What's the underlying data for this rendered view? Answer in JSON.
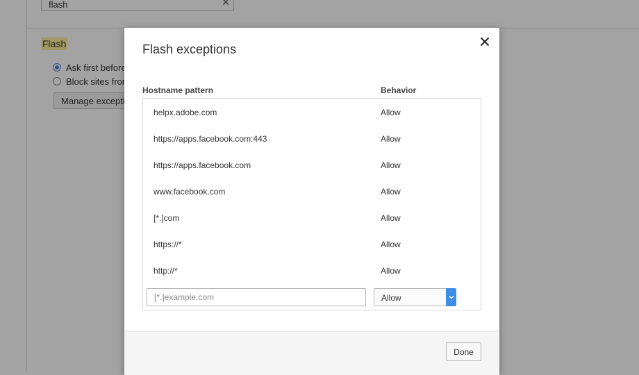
{
  "background": {
    "search": {
      "value": "flash",
      "clear_icon": "close-icon"
    },
    "section_title": "Flash",
    "radio_options": [
      {
        "label": "Ask first before",
        "checked": true
      },
      {
        "label": "Block sites from",
        "checked": false
      }
    ],
    "manage_button_label": "Manage exceptio"
  },
  "dialog": {
    "title": "Flash exceptions",
    "close_icon": "close-icon",
    "columns": {
      "host": "Hostname pattern",
      "behavior": "Behavior"
    },
    "rows": [
      {
        "host": "helpx.adobe.com",
        "behavior": "Allow"
      },
      {
        "host": "https://apps.facebook.com:443",
        "behavior": "Allow"
      },
      {
        "host": "https://apps.facebook.com",
        "behavior": "Allow"
      },
      {
        "host": "www.facebook.com",
        "behavior": "Allow"
      },
      {
        "host": "[*.]com",
        "behavior": "Allow"
      },
      {
        "host": "https://*",
        "behavior": "Allow"
      },
      {
        "host": "http://*",
        "behavior": "Allow"
      }
    ],
    "new_entry": {
      "placeholder": "[*.]example.com",
      "behavior_selected": "Allow",
      "dropdown_icon": "chevron-down-icon"
    },
    "done_label": "Done"
  },
  "colors": {
    "accent": "#3f8ee6",
    "highlight": "#fdf19a"
  }
}
